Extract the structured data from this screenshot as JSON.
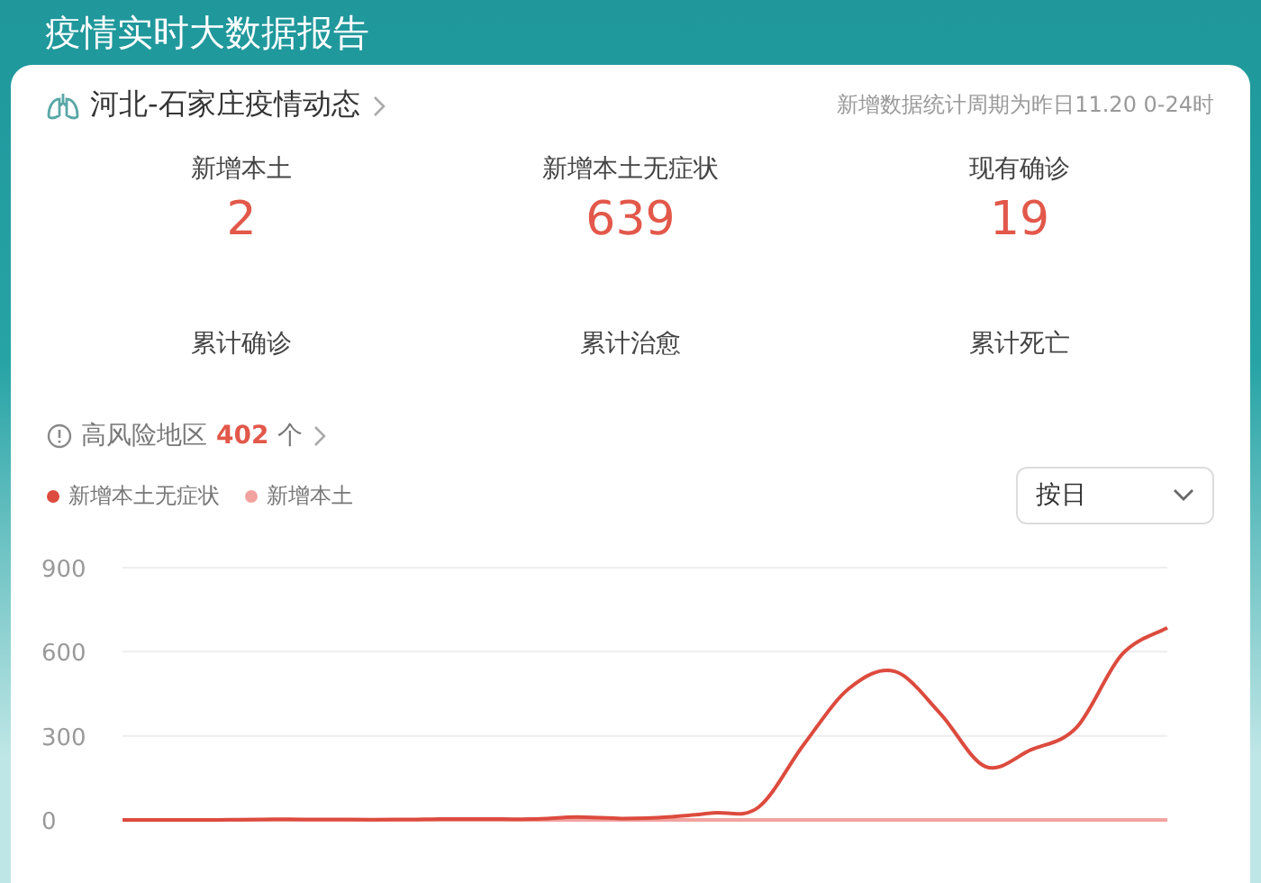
{
  "page_title": "疫情实时大数据报告",
  "card": {
    "title": "河北-石家庄疫情动态",
    "note": "新增数据统计周期为昨日11.20 0-24时",
    "stats": [
      {
        "label": "新增本土",
        "value": "2"
      },
      {
        "label": "新增本土无症状",
        "value": "639"
      },
      {
        "label": "现有确诊",
        "value": "19"
      },
      {
        "label": "累计确诊"
      },
      {
        "label": "累计治愈"
      },
      {
        "label": "累计死亡"
      }
    ],
    "risk": {
      "label": "高风险地区",
      "count": "402",
      "unit": "个"
    },
    "period_select": {
      "value": "按日"
    },
    "chart_data": {
      "type": "line",
      "ylim": [
        0,
        900
      ],
      "yticks": [
        0,
        300,
        600,
        900
      ],
      "series": [
        {
          "name": "新增本土无症状",
          "color": "#dc4b3e",
          "values": [
            0,
            0,
            0,
            2,
            2,
            1,
            1,
            3,
            3,
            3,
            10,
            5,
            10,
            25,
            45,
            270,
            470,
            530,
            380,
            190,
            250,
            330,
            590,
            685
          ]
        },
        {
          "name": "新增本土",
          "color": "#f2a3a0",
          "values": [
            0,
            0,
            0,
            0,
            0,
            0,
            0,
            0,
            0,
            0,
            0,
            0,
            0,
            0,
            0,
            0,
            0,
            0,
            0,
            0,
            0,
            0,
            0,
            0
          ]
        }
      ]
    }
  }
}
